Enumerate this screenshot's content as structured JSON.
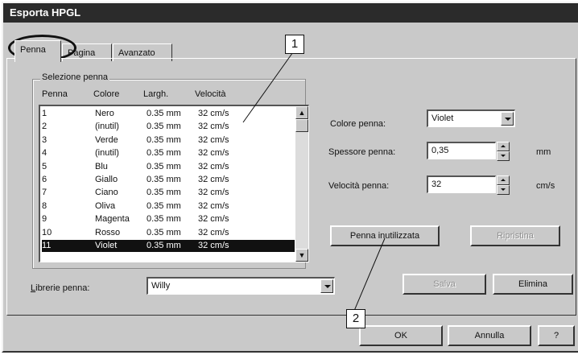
{
  "window": {
    "title": "Esporta HPGL"
  },
  "tabs": [
    {
      "label": "Penna"
    },
    {
      "label": "Pagina"
    },
    {
      "label": "Avanzato"
    }
  ],
  "pen_selection": {
    "group_label": "Selezione penna",
    "columns": [
      "Penna",
      "Colore",
      "Largh.",
      "Velocità"
    ],
    "rows": [
      {
        "pen": "1",
        "color": "Nero",
        "width": "0.35 mm",
        "speed": "32 cm/s"
      },
      {
        "pen": "2",
        "color": "(inutil)",
        "width": "0.35 mm",
        "speed": "32 cm/s"
      },
      {
        "pen": "3",
        "color": "Verde",
        "width": "0.35 mm",
        "speed": "32 cm/s"
      },
      {
        "pen": "4",
        "color": "(inutil)",
        "width": "0.35 mm",
        "speed": "32 cm/s"
      },
      {
        "pen": "5",
        "color": "Blu",
        "width": "0.35 mm",
        "speed": "32 cm/s"
      },
      {
        "pen": "6",
        "color": "Giallo",
        "width": "0.35 mm",
        "speed": "32 cm/s"
      },
      {
        "pen": "7",
        "color": "Ciano",
        "width": "0.35 mm",
        "speed": "32 cm/s"
      },
      {
        "pen": "8",
        "color": "Oliva",
        "width": "0.35 mm",
        "speed": "32 cm/s"
      },
      {
        "pen": "9",
        "color": "Magenta",
        "width": "0.35 mm",
        "speed": "32 cm/s"
      },
      {
        "pen": "10",
        "color": "Rosso",
        "width": "0.35 mm",
        "speed": "32 cm/s"
      },
      {
        "pen": "11",
        "color": "Violet",
        "width": "0.35 mm",
        "speed": "32 cm/s"
      }
    ]
  },
  "properties": {
    "color_label": "Colore penna:",
    "color_value": "Violet",
    "thickness_label": "Spessore penna:",
    "thickness_value": "0,35",
    "thickness_unit": "mm",
    "speed_label": "Velocità penna:",
    "speed_value": "32",
    "speed_unit": "cm/s"
  },
  "buttons": {
    "unused_pen": "Penna inutilizzata",
    "restore": "Ripristina",
    "save": "Salva",
    "delete": "Elimina",
    "ok": "OK",
    "cancel": "Annulla",
    "help": "?"
  },
  "library": {
    "label": "Librerie penna:",
    "value": "Willy"
  },
  "callouts": [
    "1",
    "2"
  ]
}
